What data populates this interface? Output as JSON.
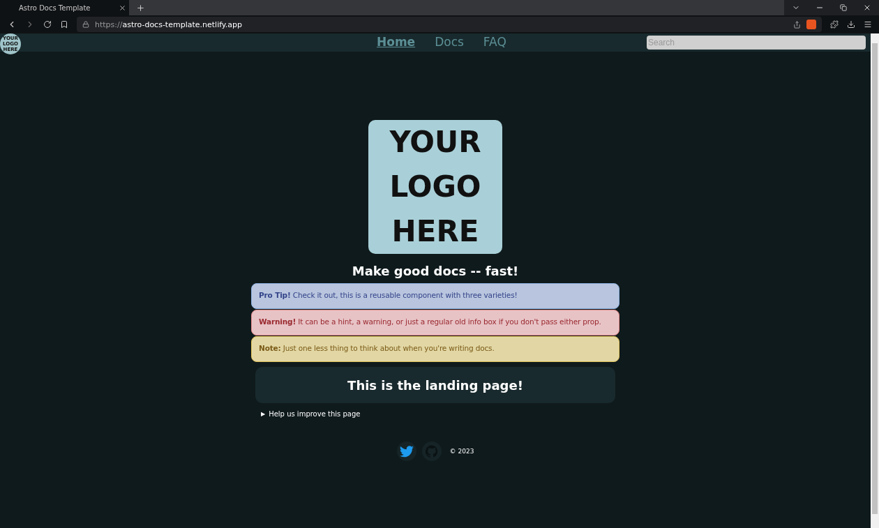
{
  "browser": {
    "tab": {
      "title": "Astro Docs Template",
      "selected": true
    },
    "address": {
      "scheme": "https://",
      "host": "astro-docs-template.netlify.app"
    }
  },
  "nav": {
    "logo": [
      "YOUR",
      "LOGO",
      "HERE"
    ],
    "links": [
      {
        "label": "Home",
        "selected": true
      },
      {
        "label": "Docs",
        "selected": false
      },
      {
        "label": "FAQ",
        "selected": false
      }
    ],
    "search": {
      "placeholder": "Search"
    }
  },
  "hero": {
    "logo": [
      "YOUR",
      "LOGO",
      "HERE"
    ],
    "tagline": "Make good docs -- fast!"
  },
  "callouts": [
    {
      "kind": "tip",
      "title": "Pro Tip!",
      "text": "Check it out, this is a reusable component with three varieties!"
    },
    {
      "kind": "warning",
      "title": "Warning!",
      "text": "It can be a hint, a warning, or just a regular old info box if you don't pass either prop."
    },
    {
      "kind": "note",
      "title": "Note:",
      "text": "Just one less thing to think about when you're writing docs."
    }
  ],
  "landing": {
    "heading": "This is the landing page!"
  },
  "feedback": {
    "marker": "▶",
    "label": "Help us improve this page",
    "expanded": false
  },
  "footer": {
    "copyright": "© 2023"
  }
}
